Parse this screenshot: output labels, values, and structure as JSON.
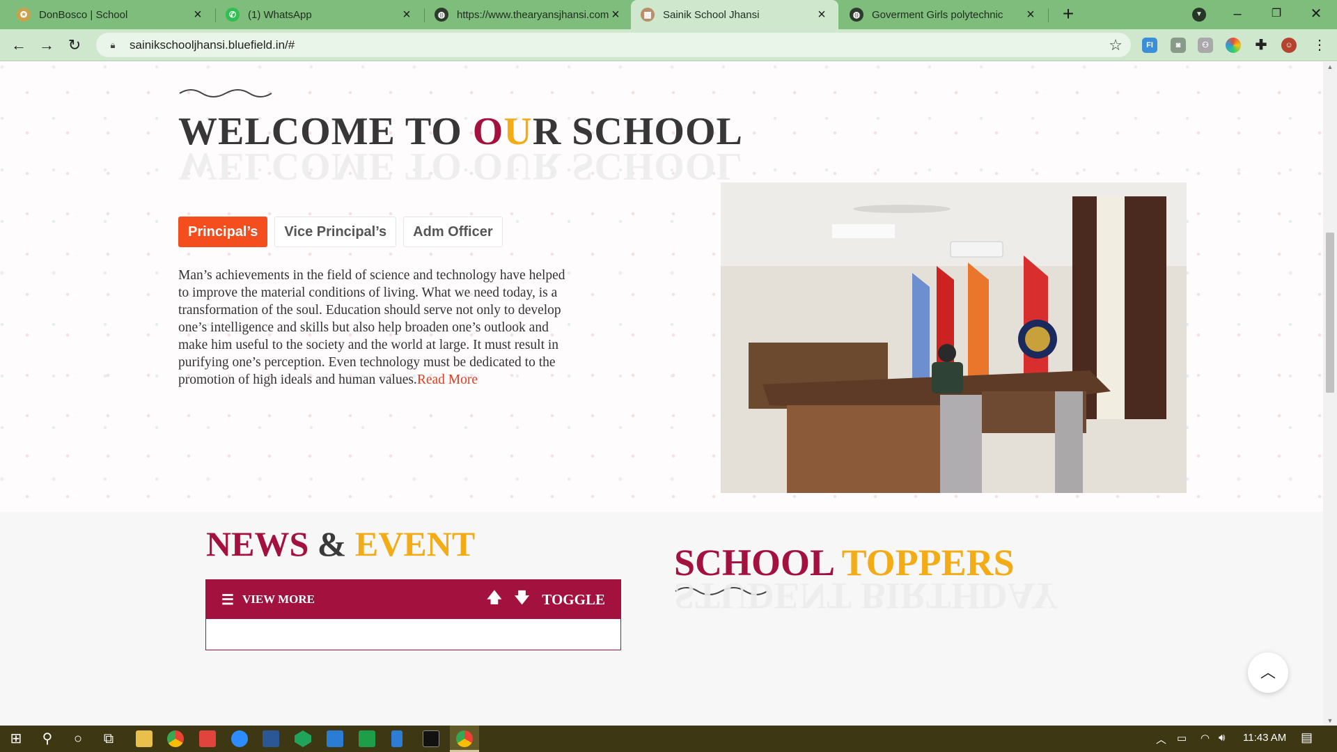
{
  "browser": {
    "tabs": [
      {
        "title": "DonBosco | School",
        "icon": "school-logo-icon"
      },
      {
        "title": "(1) WhatsApp",
        "icon": "whatsapp-icon"
      },
      {
        "title": "https://www.thearyansjhansi.com",
        "icon": "globe-icon"
      },
      {
        "title": "Sainik School Jhansi",
        "icon": "school-logo-icon"
      },
      {
        "title": "Goverment Girls polytechnic",
        "icon": "globe-icon"
      }
    ],
    "active_tab": 3,
    "url": "sainikschooljhansi.bluefield.in/#",
    "extensions": [
      "fi-extension-icon",
      "camera-icon",
      "people-icon",
      "color-picker-icon",
      "puzzle-icon",
      "profile-avatar"
    ]
  },
  "welcome": {
    "title_pre": "WELCOME TO ",
    "title_o": "O",
    "title_u": "U",
    "title_post": "R SCHOOL",
    "shadow_text": "WELCOME TO OUR SCHOOL",
    "tabs": [
      "Principal’s",
      "Vice Principal’s",
      "Adm Officer"
    ],
    "active_tab": 0,
    "message": "Man’s achievements in the field of science and technology have helped to improve the material conditions of living. What we need today, is a transformation of the soul. Education should serve not only to develop one’s intelligence and skills but also help broaden one’s outlook and make him useful to the society and the world at large. It must result in purifying one’s perception. Even technology must be dedicated to the promotion of high ideals and human values.",
    "read_more": "Read More"
  },
  "news": {
    "title_a": "NEWS",
    "title_b": " & ",
    "title_c": "EVENT",
    "view_more": "VIEW MORE",
    "toggle": "TOGGLE"
  },
  "toppers": {
    "title_a": "SCHOOL ",
    "title_b": "TOPPERS",
    "shadow_text": "STUDENT BIRTHDAY"
  },
  "taskbar": {
    "time": "11:43 AM"
  },
  "colors": {
    "maroon": "#a3123e",
    "gold": "#f3ab16",
    "orange_tab": "#f44d1e",
    "browser_green": "#7fbd7c"
  }
}
